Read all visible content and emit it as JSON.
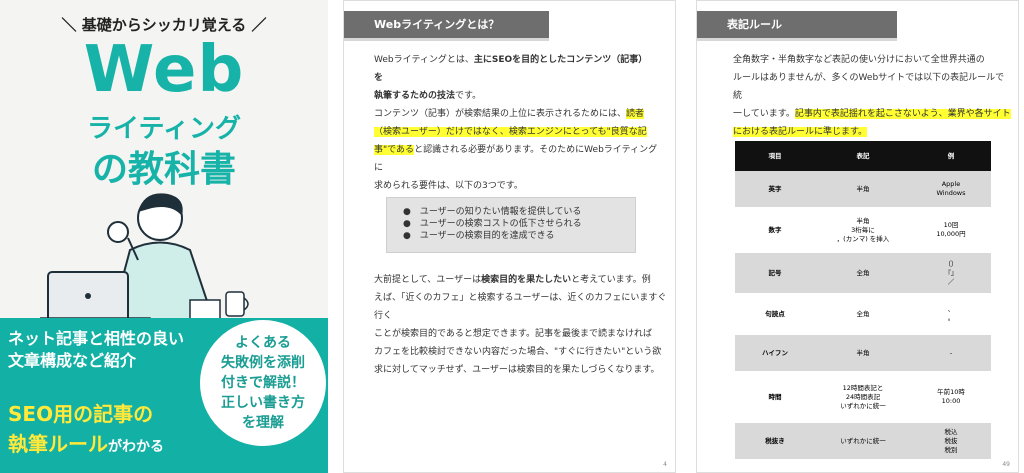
{
  "cover": {
    "tagline": "＼ 基礎からシッカリ覚える ／",
    "title_web": "Web",
    "title_writing": "ライティング",
    "title_book": "の教科書",
    "subtitle_line1": "ネット記事と相性の良い",
    "subtitle_line2": "文章構成など紹介",
    "seo_line1": "SEO用の記事の",
    "seo_line2_main": "執筆ルール",
    "seo_line2_small": "がわかる",
    "badge_line1": "よくある",
    "badge_line2": "失敗例を添削",
    "badge_line3": "付きで解説！",
    "badge_line4": "正しい書き方",
    "badge_line5": "を理解",
    "colors": {
      "teal": "#13b0a5",
      "yellow": "#ffe93a"
    }
  },
  "page4": {
    "heading": "Webライティングとは？",
    "p1_a": "Webライティングとは、",
    "p1_b": "主にSEOを目的としたコンテンツ（記事）を",
    "p1_c": "執筆するための技法",
    "p1_d": "です。",
    "p2_a": "コンテンツ（記事）が検索結果の上位に表示されるためには、",
    "p2_hl1": "読者",
    "p2_hl2": "（検索ユーザー）だけではなく、検索エンジンにとっても\"良質な記",
    "p2_hl3": "事\"である",
    "p2_b": "と認識される必要があります。そのためにWebライティングに",
    "p2_c": "求められる要件は、以下の3つです。",
    "bullets": [
      "●　ユーザーの知りたい情報を提供している",
      "●　ユーザーの検索コストの低下させられる",
      "●　ユーザーの検索目的を達成できる"
    ],
    "p3_l1a": "大前提として、ユーザーは",
    "p3_l1b": "検索目的を果たしたい",
    "p3_l1c": "と考えています。例",
    "p3_l2": "えば、「近くのカフェ」と検索するユーザーは、近くのカフェにいますぐ行く",
    "p3_l3": "ことが検索目的であると想定できます。記事を最後まで読まなければ",
    "p3_l4": "カフェを比較検討できない内容だった場合、\"すぐに行きたい\"という欲",
    "p3_l5": "求に対してマッチせず、ユーザーは検索目的を果たしづらくなります。",
    "page_number": "4"
  },
  "page49": {
    "heading": "表記ルール",
    "p1_l1": "全角数字・半角数字など表記の使い分けにおいて全世界共通の",
    "p1_l2": "ルールはありませんが、多くのWebサイトでは以下の表記ルールで統",
    "p1_l3": "一しています。",
    "p1_hl1": "記事内で表記揺れを起こさないよう、業界や各サイト",
    "p1_hl2": "における表記ルールに準じます。",
    "table": {
      "headers": [
        "項目",
        "表記",
        "例"
      ],
      "rows": [
        [
          "英字",
          "半角",
          "Apple\nWindows"
        ],
        [
          "数字",
          "半角\n3桁毎に\n，(カンマ) を挿入",
          "10回\n10,000円"
        ],
        [
          "記号",
          "全角",
          "（）\n『』\n／"
        ],
        [
          "句読点",
          "全角",
          "、\n。"
        ],
        [
          "ハイフン",
          "半角",
          "-"
        ],
        [
          "時間",
          "12時間表記と\n24時間表記\nいずれかに統一",
          "午前10時\n10:00"
        ],
        [
          "税抜き",
          "いずれかに統一",
          "税込\n税抜\n税別"
        ]
      ]
    },
    "page_number": "49"
  }
}
